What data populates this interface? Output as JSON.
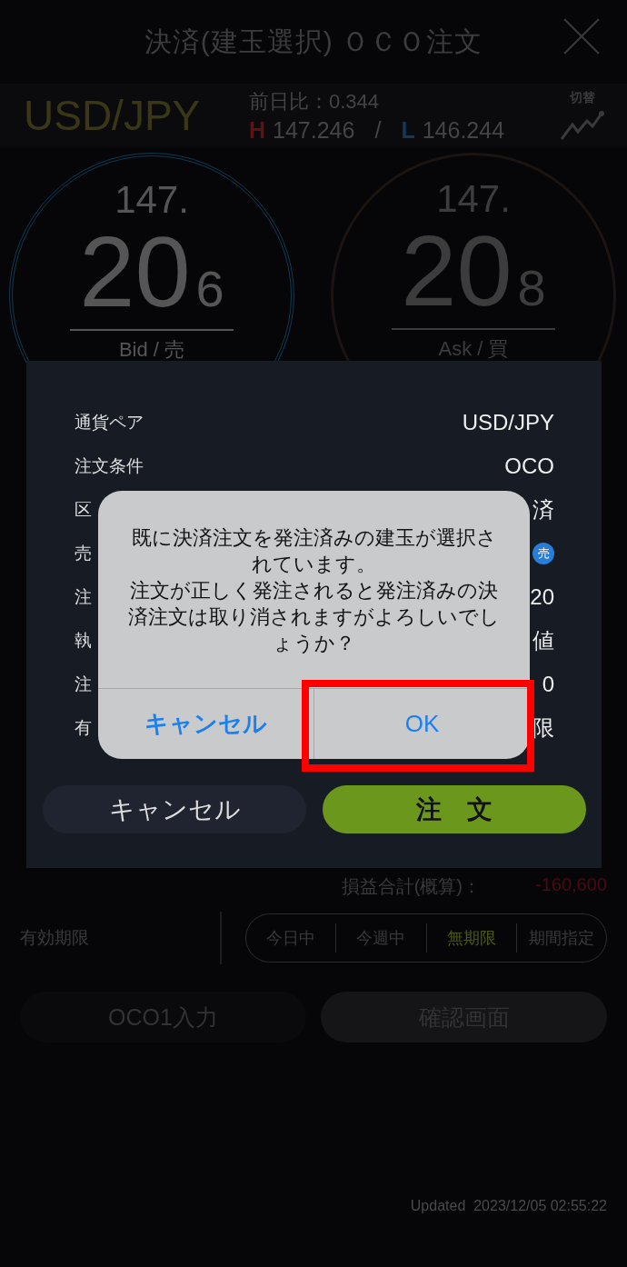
{
  "header": {
    "title": "決済(建玉選択) ＯＣＯ注文"
  },
  "rate": {
    "pair": "USD/JPY",
    "change": "前日比：0.344",
    "high_mark": "H",
    "high": "147.246",
    "separator": "/",
    "low_mark": "L",
    "low": "146.244",
    "toggle_label": "切替"
  },
  "quotes": [
    {
      "kind": "bid",
      "head": "147.",
      "pips": "20",
      "fraction": "6",
      "label": "Bid / 売"
    },
    {
      "kind": "ask",
      "head": "147.",
      "pips": "20",
      "fraction": "8",
      "label": "Ask / 買"
    }
  ],
  "summary": {
    "label": "損益合計(概算)：",
    "value": "-160,600"
  },
  "expiry": {
    "label": "有効期限",
    "options": [
      {
        "label": "今日中",
        "selected": false
      },
      {
        "label": "今週中",
        "selected": false
      },
      {
        "label": "無期限",
        "selected": true
      },
      {
        "label": "期間指定",
        "selected": false
      }
    ]
  },
  "actions": [
    {
      "label": "OCO1入力",
      "kind": "outline"
    },
    {
      "label": "確認画面",
      "kind": "filled"
    }
  ],
  "updated": "Updated  2023/12/05 02:55:22",
  "confirm_sheet": {
    "rows": [
      {
        "label": "通貨ペア",
        "value": "USD/JPY",
        "kind": "text"
      },
      {
        "label": "注文条件",
        "value": "OCO",
        "kind": "text"
      },
      {
        "label": "区",
        "value": "済",
        "kind": "text"
      },
      {
        "label": "売",
        "value": "売",
        "kind": "badge"
      },
      {
        "label": "注",
        "value": "20",
        "kind": "text"
      },
      {
        "label": "執",
        "value": "値",
        "kind": "text"
      },
      {
        "label": "注",
        "value": "0",
        "kind": "text"
      },
      {
        "label": "有",
        "value": "限",
        "kind": "text"
      }
    ],
    "buttons": [
      {
        "label": "キャンセル",
        "kind": "secondary"
      },
      {
        "label": "注　文",
        "kind": "primary"
      }
    ]
  },
  "alert": {
    "message": [
      "既に決済注文を発注済みの建玉が選択されています。",
      "注文が正しく発注されると発注済みの決済注文は取り消されますがよろしいでしょうか？"
    ],
    "buttons": [
      {
        "label": "キャンセル",
        "kind": "cancel",
        "highlighted": false
      },
      {
        "label": "OK",
        "kind": "default",
        "highlighted": true
      }
    ]
  }
}
